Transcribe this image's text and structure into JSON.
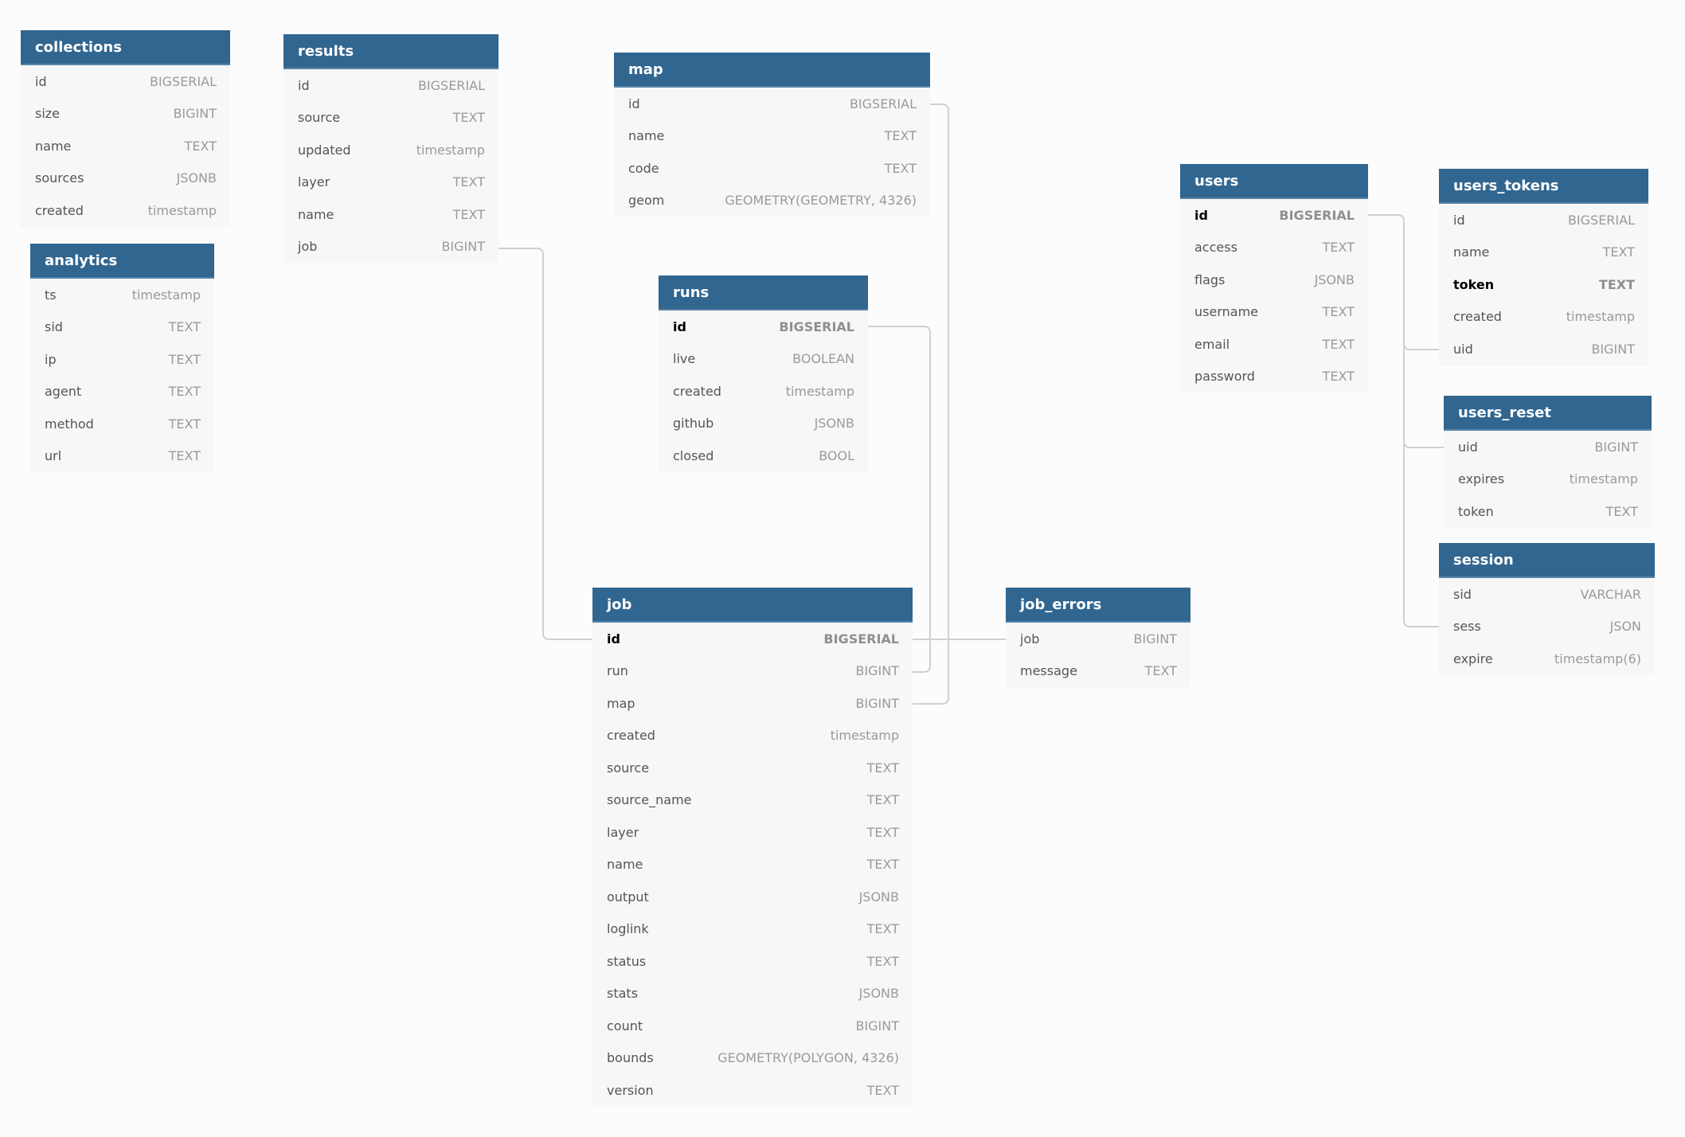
{
  "header_color": "#316690",
  "tables": [
    {
      "key": "collections",
      "title": "collections",
      "columns": [
        {
          "name": "id",
          "type": "BIGSERIAL"
        },
        {
          "name": "size",
          "type": "BIGINT"
        },
        {
          "name": "name",
          "type": "TEXT"
        },
        {
          "name": "sources",
          "type": "JSONB"
        },
        {
          "name": "created",
          "type": "timestamp"
        }
      ]
    },
    {
      "key": "analytics",
      "title": "analytics",
      "columns": [
        {
          "name": "ts",
          "type": "timestamp"
        },
        {
          "name": "sid",
          "type": "TEXT"
        },
        {
          "name": "ip",
          "type": "TEXT"
        },
        {
          "name": "agent",
          "type": "TEXT"
        },
        {
          "name": "method",
          "type": "TEXT"
        },
        {
          "name": "url",
          "type": "TEXT"
        }
      ]
    },
    {
      "key": "results",
      "title": "results",
      "columns": [
        {
          "name": "id",
          "type": "BIGSERIAL"
        },
        {
          "name": "source",
          "type": "TEXT"
        },
        {
          "name": "updated",
          "type": "timestamp"
        },
        {
          "name": "layer",
          "type": "TEXT"
        },
        {
          "name": "name",
          "type": "TEXT"
        },
        {
          "name": "job",
          "type": "BIGINT"
        }
      ]
    },
    {
      "key": "map",
      "title": "map",
      "columns": [
        {
          "name": "id",
          "type": "BIGSERIAL"
        },
        {
          "name": "name",
          "type": "TEXT"
        },
        {
          "name": "code",
          "type": "TEXT"
        },
        {
          "name": "geom",
          "type": "GEOMETRY(GEOMETRY, 4326)"
        }
      ]
    },
    {
      "key": "runs",
      "title": "runs",
      "columns": [
        {
          "name": "id",
          "type": "BIGSERIAL",
          "bold": true
        },
        {
          "name": "live",
          "type": "BOOLEAN"
        },
        {
          "name": "created",
          "type": "timestamp"
        },
        {
          "name": "github",
          "type": "JSONB"
        },
        {
          "name": "closed",
          "type": "BOOL"
        }
      ]
    },
    {
      "key": "job",
      "title": "job",
      "columns": [
        {
          "name": "id",
          "type": "BIGSERIAL",
          "bold": true
        },
        {
          "name": "run",
          "type": "BIGINT"
        },
        {
          "name": "map",
          "type": "BIGINT"
        },
        {
          "name": "created",
          "type": "timestamp"
        },
        {
          "name": "source",
          "type": "TEXT"
        },
        {
          "name": "source_name",
          "type": "TEXT"
        },
        {
          "name": "layer",
          "type": "TEXT"
        },
        {
          "name": "name",
          "type": "TEXT"
        },
        {
          "name": "output",
          "type": "JSONB"
        },
        {
          "name": "loglink",
          "type": "TEXT"
        },
        {
          "name": "status",
          "type": "TEXT"
        },
        {
          "name": "stats",
          "type": "JSONB"
        },
        {
          "name": "count",
          "type": "BIGINT"
        },
        {
          "name": "bounds",
          "type": "GEOMETRY(POLYGON, 4326)"
        },
        {
          "name": "version",
          "type": "TEXT"
        }
      ]
    },
    {
      "key": "job_errors",
      "title": "job_errors",
      "columns": [
        {
          "name": "job",
          "type": "BIGINT"
        },
        {
          "name": "message",
          "type": "TEXT"
        }
      ]
    },
    {
      "key": "users",
      "title": "users",
      "columns": [
        {
          "name": "id",
          "type": "BIGSERIAL",
          "bold": true
        },
        {
          "name": "access",
          "type": "TEXT"
        },
        {
          "name": "flags",
          "type": "JSONB"
        },
        {
          "name": "username",
          "type": "TEXT"
        },
        {
          "name": "email",
          "type": "TEXT"
        },
        {
          "name": "password",
          "type": "TEXT"
        }
      ]
    },
    {
      "key": "users_tokens",
      "title": "users_tokens",
      "columns": [
        {
          "name": "id",
          "type": "BIGSERIAL"
        },
        {
          "name": "name",
          "type": "TEXT"
        },
        {
          "name": "token",
          "type": "TEXT",
          "bold": true
        },
        {
          "name": "created",
          "type": "timestamp"
        },
        {
          "name": "uid",
          "type": "BIGINT"
        }
      ]
    },
    {
      "key": "users_reset",
      "title": "users_reset",
      "columns": [
        {
          "name": "uid",
          "type": "BIGINT"
        },
        {
          "name": "expires",
          "type": "timestamp"
        },
        {
          "name": "token",
          "type": "TEXT"
        }
      ]
    },
    {
      "key": "session",
      "title": "session",
      "columns": [
        {
          "name": "sid",
          "type": "VARCHAR"
        },
        {
          "name": "sess",
          "type": "JSON"
        },
        {
          "name": "expire",
          "type": "timestamp(6)"
        }
      ]
    }
  ],
  "relations": [
    {
      "from": "results.job",
      "to": "job.id"
    },
    {
      "from": "job.map",
      "to": "map.id"
    },
    {
      "from": "job.run",
      "to": "runs.id"
    },
    {
      "from": "job_errors.job",
      "to": "job.id"
    },
    {
      "from": "users_tokens.uid",
      "to": "users.id"
    },
    {
      "from": "users_reset.uid",
      "to": "users.id"
    },
    {
      "from": "session.sess",
      "to": "users.id"
    }
  ]
}
